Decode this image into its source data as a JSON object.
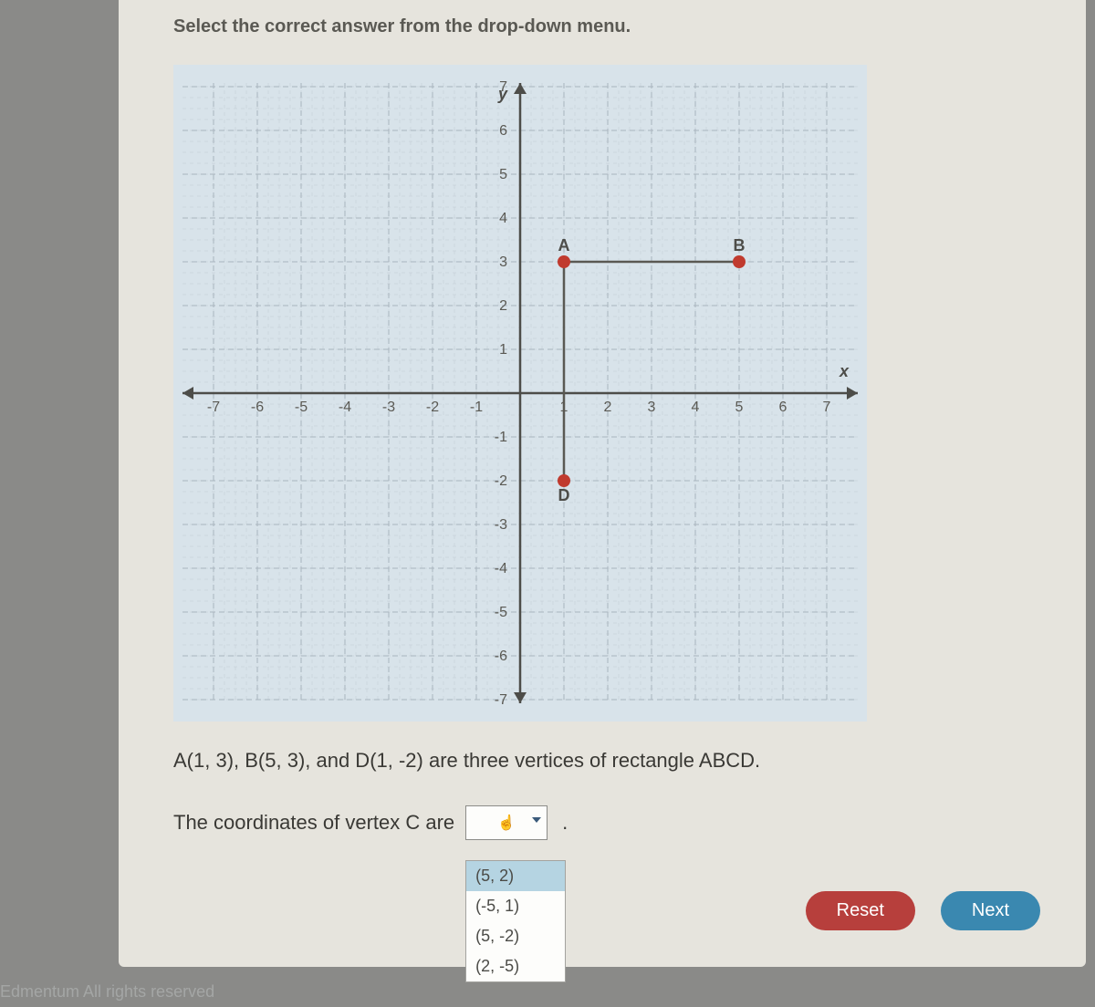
{
  "instruction": "Select the correct answer from the drop-down menu.",
  "info_text": "A(1, 3), B(5, 3), and D(1, -2) are three vertices of rectangle ABCD.",
  "answer_prefix": "The coordinates of vertex C are",
  "period": ".",
  "dropdown": {
    "options": [
      "(5, 2)",
      "(-5, 1)",
      "(5, -2)",
      "(2, -5)"
    ]
  },
  "buttons": {
    "reset": "Reset",
    "next": "Next"
  },
  "footer": "Edmentum  All rights reserved",
  "chart_data": {
    "type": "scatter",
    "title": "",
    "xlabel": "x",
    "ylabel": "y",
    "xlim": [
      -7,
      7
    ],
    "ylim": [
      -7,
      7
    ],
    "x_ticks": [
      -7,
      -6,
      -5,
      -4,
      -3,
      -2,
      -1,
      1,
      2,
      3,
      4,
      5,
      6,
      7
    ],
    "y_ticks": [
      -7,
      -6,
      -5,
      -4,
      -3,
      -2,
      -1,
      1,
      2,
      3,
      4,
      5,
      6,
      7
    ],
    "points": [
      {
        "name": "A",
        "x": 1,
        "y": 3
      },
      {
        "name": "B",
        "x": 5,
        "y": 3
      },
      {
        "name": "D",
        "x": 1,
        "y": -2
      }
    ],
    "segments": [
      {
        "from": "A",
        "to": "B"
      },
      {
        "from": "A",
        "to": "D"
      }
    ]
  }
}
